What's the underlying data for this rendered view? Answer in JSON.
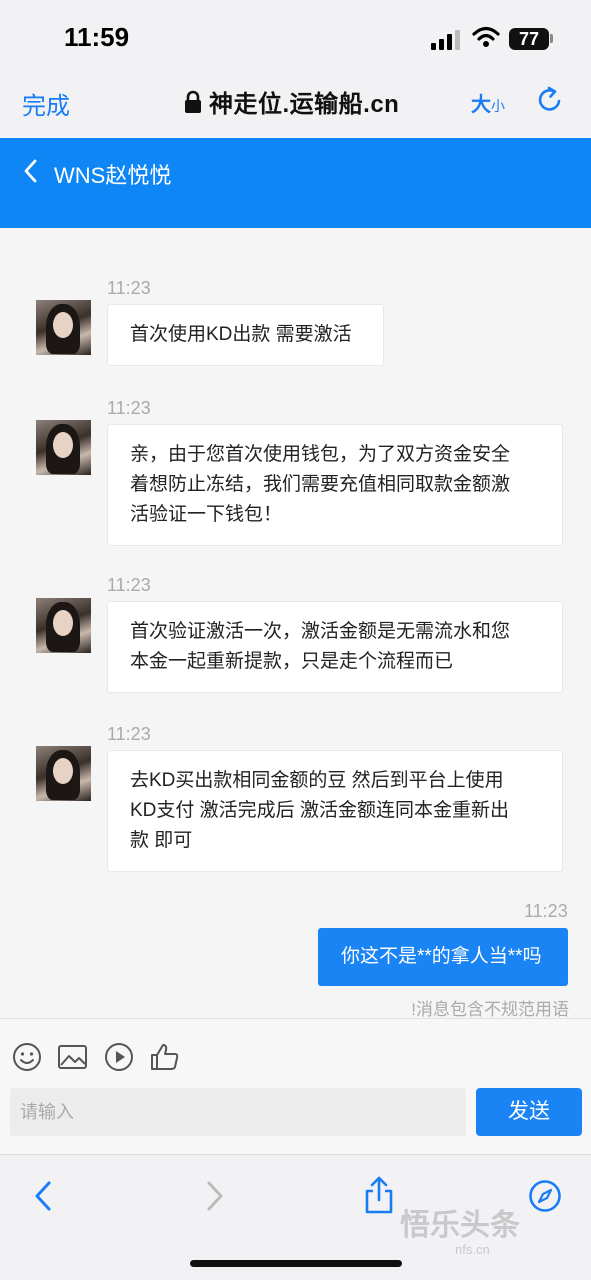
{
  "status_bar": {
    "time": "11:59",
    "battery": "77"
  },
  "browser": {
    "done_label": "完成",
    "url": "神走位.运输船.cn",
    "text_size_large": "大",
    "text_size_small": "小"
  },
  "chat": {
    "title": "WNS赵悦悦",
    "messages": [
      {
        "side": "left",
        "time": "11:23",
        "text": "首次使用KD出款 需要激活"
      },
      {
        "side": "left",
        "time": "11:23",
        "lines": [
          "亲，由于您首次使用钱包，为了双方资金安全",
          "着想防止冻结，我们需要充值相同取款金额激",
          "活验证一下钱包！"
        ]
      },
      {
        "side": "left",
        "time": "11:23",
        "lines": [
          "首次验证激活一次，激活金额是无需流水和您",
          "本金一起重新提款，只是走个流程而已"
        ]
      },
      {
        "side": "left",
        "time": "11:23",
        "lines": [
          "去KD买出款相同金额的豆 然后到平台上使用",
          "KD支付 激活完成后 激活金额连同本金重新出",
          "款 即可"
        ]
      },
      {
        "side": "right",
        "time": "11:23",
        "text": "你这不是**的拿人当**吗",
        "warning": "!消息包含不规范用语"
      }
    ]
  },
  "input": {
    "placeholder": "请输入",
    "send_label": "发送"
  },
  "watermark": {
    "brand": "悟乐头条",
    "sub": "nfs.cn"
  },
  "colors": {
    "accent": "#1a84f5",
    "header": "#0f86f5"
  }
}
